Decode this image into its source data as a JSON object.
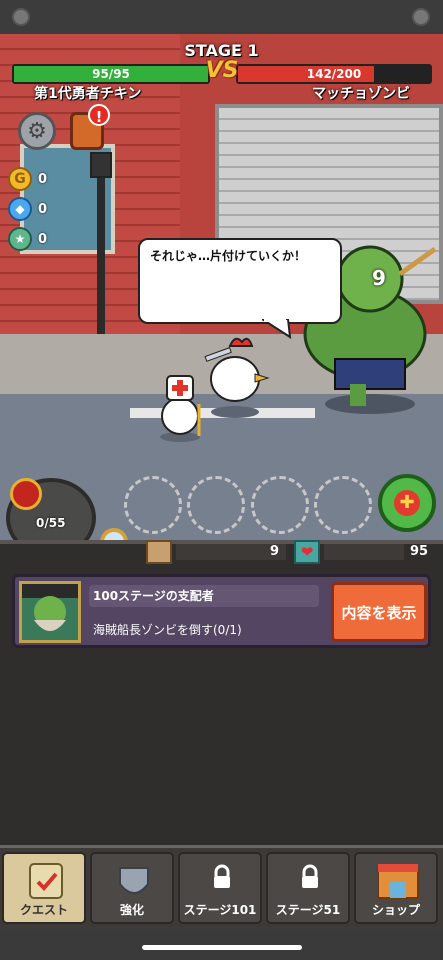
{
  "stage": {
    "title": "STAGE 1"
  },
  "player": {
    "name": "第1代勇者チキン",
    "hp": "95/95",
    "hp_fraction": 1.0
  },
  "enemy": {
    "name": "マッチョゾンビ",
    "hp": "142/200",
    "hp_fraction": 0.71,
    "damage_popup": "9"
  },
  "vs_label": "VS",
  "currencies": [
    {
      "icon": "gold-coin-icon",
      "value": "0"
    },
    {
      "icon": "diamond-icon",
      "value": "0"
    },
    {
      "icon": "medal-icon",
      "value": "0"
    }
  ],
  "speech": {
    "text": "それじゃ…片付けていくか！"
  },
  "orb": {
    "value": "0/55"
  },
  "stats": {
    "attack": "9",
    "health": "95"
  },
  "quest": {
    "title": "100ステージの支配者",
    "description": "海賊船長ゾンビを倒す(0/1)",
    "button_label": "内容を表示"
  },
  "tabs": [
    {
      "label": "クエスト",
      "icon": "scroll-icon",
      "active": true
    },
    {
      "label": "強化",
      "icon": "armor-icon",
      "active": false
    },
    {
      "label": "ステージ101",
      "icon": "lock-icon",
      "active": false
    },
    {
      "label": "ステージ51",
      "icon": "lock-icon",
      "active": false
    },
    {
      "label": "ショップ",
      "icon": "shop-icon",
      "active": false
    }
  ],
  "colors": {
    "player_hp": "#33b03b",
    "enemy_hp": "#d9382f",
    "accent_orange": "#ef6b39",
    "quest_card": "#544663"
  }
}
